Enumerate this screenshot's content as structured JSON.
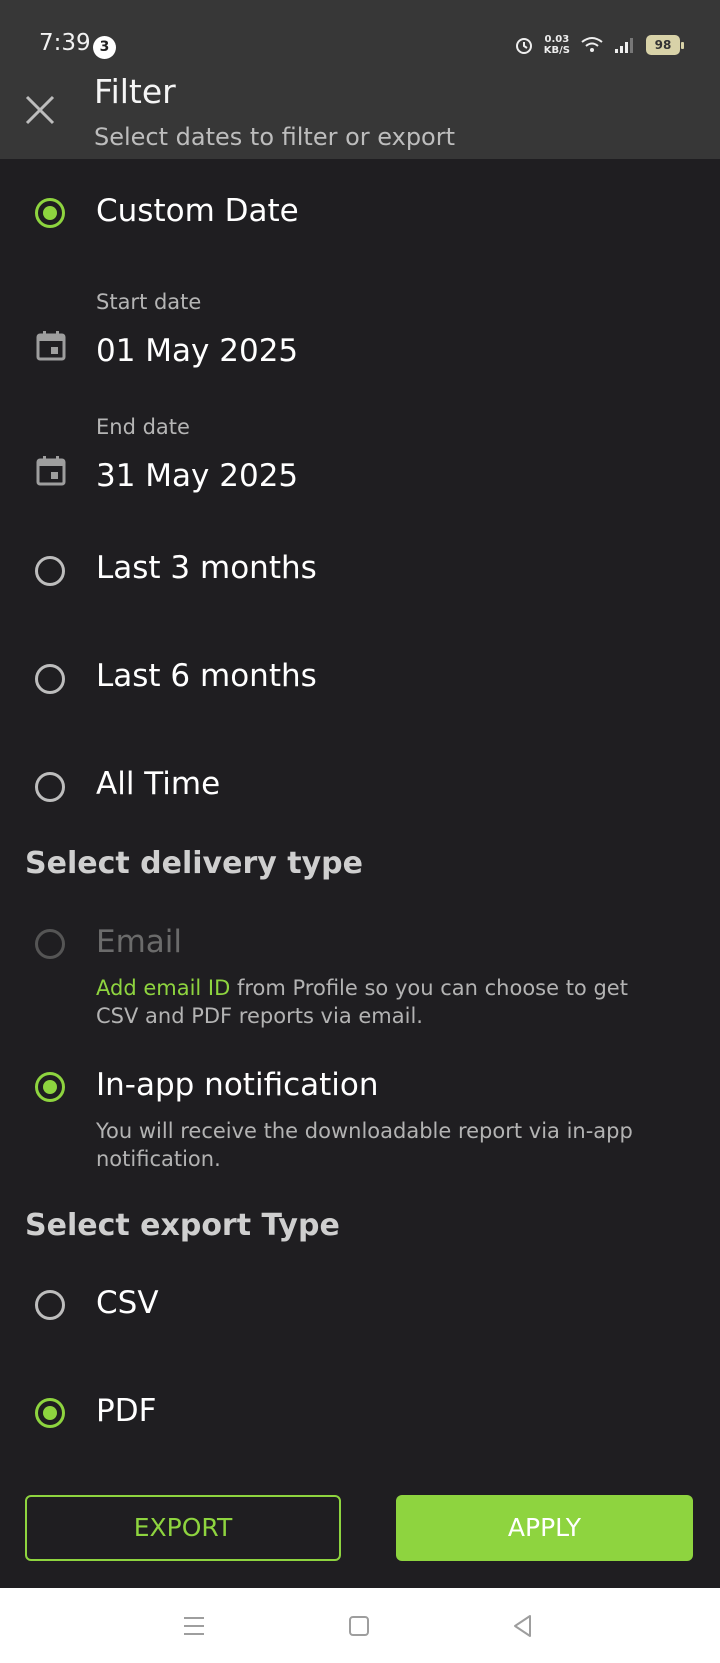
{
  "status_bar": {
    "time": "7:39",
    "notif_count": "3",
    "speed_top": "0.03",
    "speed_unit": "KB/S",
    "battery": "98"
  },
  "header": {
    "title": "Filter",
    "subtitle": "Select dates to filter or export"
  },
  "date_options": {
    "custom": "Custom Date",
    "start_label": "Start date",
    "start_value": "01 May 2025",
    "end_label": "End date",
    "end_value": "31 May 2025",
    "last3": "Last 3 months",
    "last6": "Last 6 months",
    "all_time": "All Time"
  },
  "delivery": {
    "title": "Select delivery type",
    "email": "Email",
    "email_link": "Add email ID",
    "email_desc": " from Profile so you can choose to get CSV and PDF reports via email.",
    "inapp": "In-app notification",
    "inapp_desc": "You will receive the downloadable report via in-app notification."
  },
  "export_type": {
    "title": "Select export Type",
    "csv": "CSV",
    "pdf": "PDF"
  },
  "buttons": {
    "export": "EXPORT",
    "apply": "APPLY"
  },
  "colors": {
    "accent": "#8ed43f",
    "background": "#1f1e21",
    "header": "#373737"
  }
}
